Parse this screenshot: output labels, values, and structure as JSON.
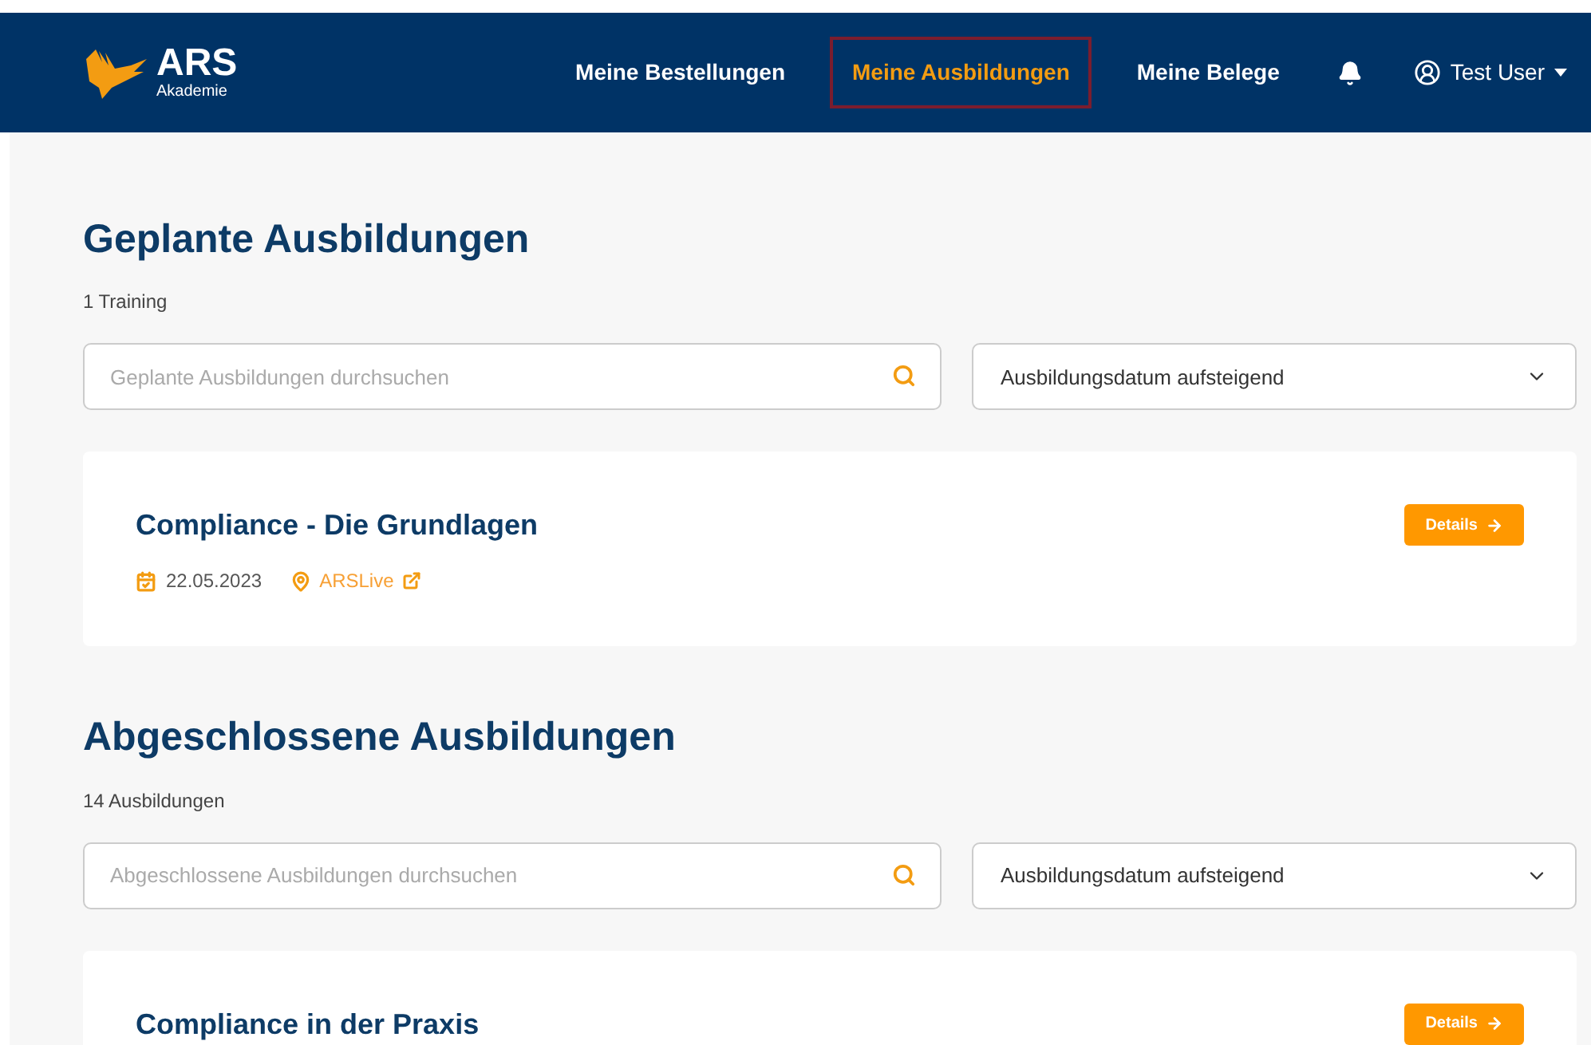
{
  "brand": {
    "name": "ARS",
    "subtitle": "Akademie"
  },
  "nav": [
    {
      "label": "Meine Bestellungen",
      "selected": false
    },
    {
      "label": "Meine Ausbildungen",
      "selected": true
    },
    {
      "label": "Meine Belege",
      "selected": false
    }
  ],
  "user": {
    "name": "Test User"
  },
  "sections": [
    {
      "title": "Geplante Ausbildungen",
      "count": "1 Training",
      "search": {
        "placeholder": "Geplante Ausbildungen durchsuchen"
      },
      "sort": {
        "value": "Ausbildungsdatum aufsteigend"
      },
      "courses": [
        {
          "title": "Compliance - Die Grundlagen",
          "date": "22.05.2023",
          "location": "ARSLive",
          "button": "Details"
        }
      ]
    },
    {
      "title": "Abgeschlossene Ausbildungen",
      "count": "14 Ausbildungen",
      "search": {
        "placeholder": "Abgeschlossene Ausbildungen durchsuchen"
      },
      "sort": {
        "value": "Ausbildungsdatum aufsteigend"
      },
      "courses": [
        {
          "title": "Compliance in der Praxis",
          "button": "Details"
        }
      ]
    }
  ]
}
